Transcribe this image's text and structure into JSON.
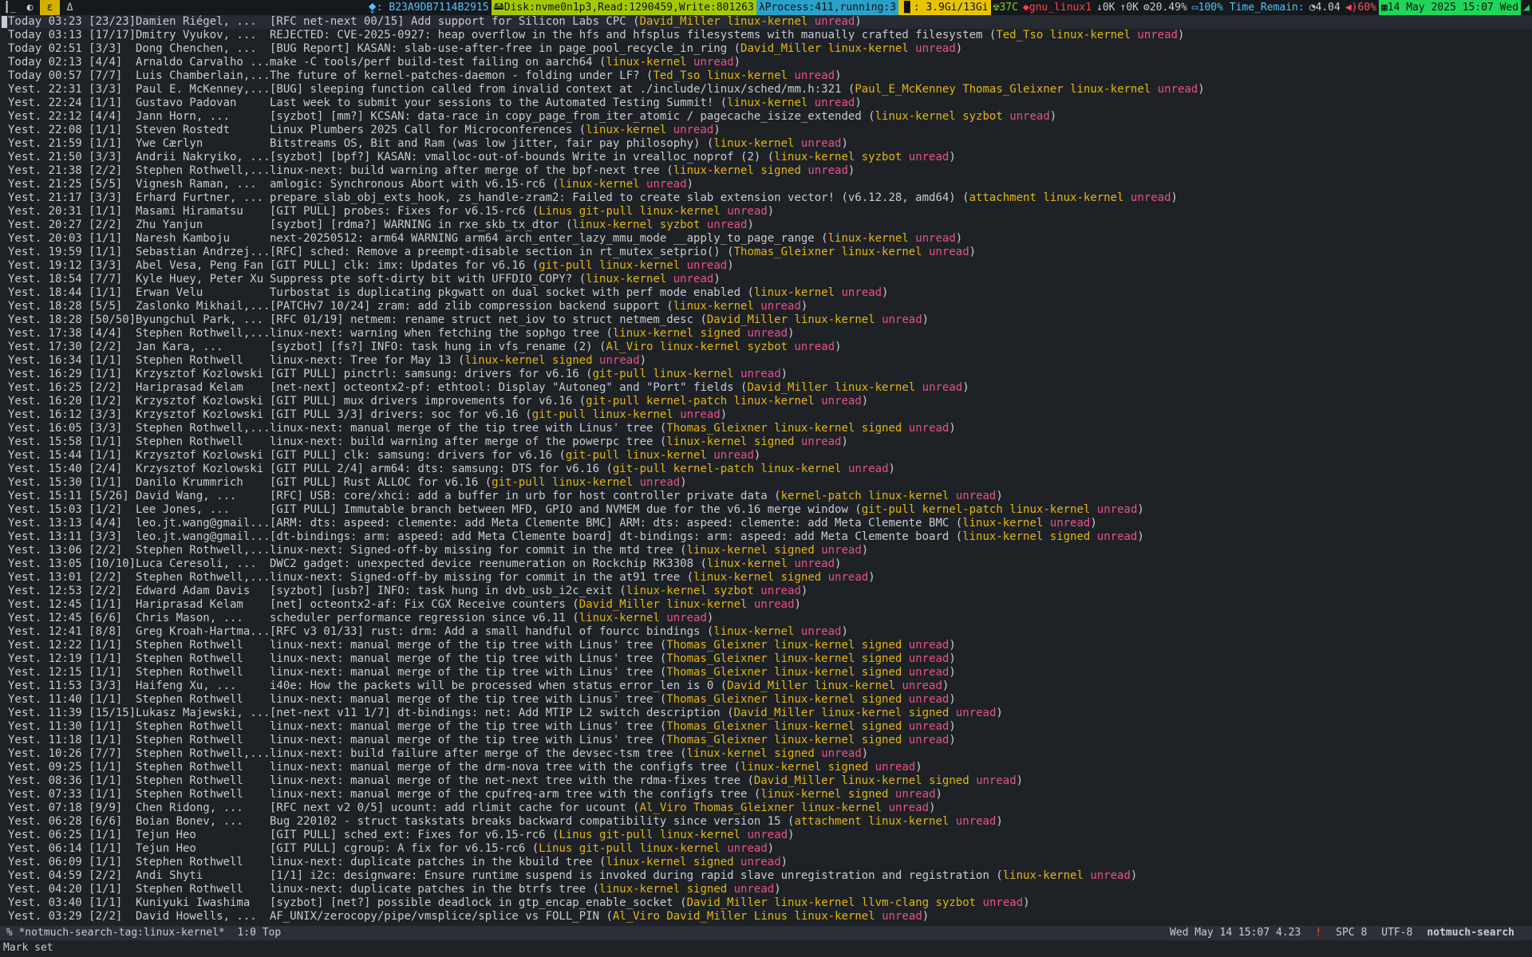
{
  "topbar": {
    "workspaces": [
      "┃_",
      "◐",
      "ε",
      "Δ"
    ],
    "active_workspace": 2,
    "ip_label": "⧪: B23A9DB7114B2915",
    "disk": "Disk:nvme0n1p3,Read:1290459,Write:801263",
    "process": "Process:411,running:3",
    "mem": ": 3.9Gi/13Gi",
    "temp": "37C",
    "wifi": "gnu_linux1",
    "down": "0K",
    "up": "0K",
    "cpu": "20.49%",
    "battery": "100% Time_Remain:",
    "load": "4.04",
    "volume": "60%",
    "datetime": "14 May 2025 15:07 Wed",
    "colors": {
      "disk": "#a4c900",
      "process": "#2aa1c9",
      "mem": "#e7c400",
      "temp": "#7ed321",
      "wifi": "#ff4545",
      "net": "#4fc3f7",
      "cpu": "#c8ccd2",
      "battery": "#4fc3f7",
      "load": "#c8ccd2",
      "volume": "#ff5555",
      "datetime": "#1fd65a"
    }
  },
  "emails": [
    {
      "date": "Today 03:23",
      "count": "[23/23]",
      "from": "Damien Riégel, ...",
      "subject": "[RFC net-next 00/15] Add support for Silicon Labs CPC",
      "tags": [
        "David_Miller",
        "linux-kernel",
        "unread"
      ]
    },
    {
      "date": "Today 03:13",
      "count": "[17/17]",
      "from": "Dmitry Vyukov, ...",
      "subject": "REJECTED: CVE-2025-0927: heap overflow in the hfs and hfsplus filesystems with manually crafted filesystem",
      "tags": [
        "Ted_Tso",
        "linux-kernel",
        "unread"
      ]
    },
    {
      "date": "Today 02:51",
      "count": "[3/3]",
      "from": "Dong Chenchen, ...",
      "subject": "[BUG Report] KASAN: slab-use-after-free in page_pool_recycle_in_ring",
      "tags": [
        "David_Miller",
        "linux-kernel",
        "unread"
      ]
    },
    {
      "date": "Today 02:13",
      "count": "[4/4]",
      "from": "Arnaldo Carvalho ...",
      "subject": "make -C tools/perf build-test failing on aarch64",
      "tags": [
        "linux-kernel",
        "unread"
      ]
    },
    {
      "date": "Today 00:57",
      "count": "[7/7]",
      "from": "Luis Chamberlain,...",
      "subject": "The future of kernel-patches-daemon - folding under LF?",
      "tags": [
        "Ted_Tso",
        "linux-kernel",
        "unread"
      ]
    },
    {
      "date": "Yest. 22:31",
      "count": "[3/3]",
      "from": "Paul E. McKenney,...",
      "subject": "[BUG] sleeping function called from invalid context at ./include/linux/sched/mm.h:321",
      "tags": [
        "Paul_E_McKenney",
        "Thomas_Gleixner",
        "linux-kernel",
        "unread"
      ]
    },
    {
      "date": "Yest. 22:24",
      "count": "[1/1]",
      "from": "Gustavo Padovan",
      "subject": "Last week to submit your sessions to the Automated Testing Summit!",
      "tags": [
        "linux-kernel",
        "unread"
      ]
    },
    {
      "date": "Yest. 22:12",
      "count": "[4/4]",
      "from": "Jann Horn, ...",
      "subject": "[syzbot] [mm?] KCSAN: data-race in copy_page_from_iter_atomic / pagecache_isize_extended",
      "tags": [
        "linux-kernel",
        "syzbot",
        "unread"
      ]
    },
    {
      "date": "Yest. 22:08",
      "count": "[1/1]",
      "from": "Steven Rostedt",
      "subject": "Linux Plumbers 2025 Call for Microconferences",
      "tags": [
        "linux-kernel",
        "unread"
      ]
    },
    {
      "date": "Yest. 21:59",
      "count": "[1/1]",
      "from": "Ywe Cærlyn",
      "subject": "Bitstreams OS, Bit and Ram (was low jitter, fair pay philosophy)",
      "tags": [
        "linux-kernel",
        "unread"
      ]
    },
    {
      "date": "Yest. 21:50",
      "count": "[3/3]",
      "from": "Andrii Nakryiko, ...",
      "subject": "[syzbot] [bpf?] KASAN: vmalloc-out-of-bounds Write in vrealloc_noprof (2)",
      "tags": [
        "linux-kernel",
        "syzbot",
        "unread"
      ]
    },
    {
      "date": "Yest. 21:38",
      "count": "[2/2]",
      "from": "Stephen Rothwell,...",
      "subject": "linux-next: build warning after merge of the bpf-next tree",
      "tags": [
        "linux-kernel",
        "signed",
        "unread"
      ]
    },
    {
      "date": "Yest. 21:25",
      "count": "[5/5]",
      "from": "Vignesh Raman, ...",
      "subject": "amlogic: Synchronous Abort with v6.15-rc6",
      "tags": [
        "linux-kernel",
        "unread"
      ]
    },
    {
      "date": "Yest. 21:17",
      "count": "[3/3]",
      "from": "Erhard Furtner, ...",
      "subject": "prepare_slab_obj_exts_hook, zs_handle-zram2: Failed to create slab extension vector! (v6.12.28, amd64)",
      "tags": [
        "attachment",
        "linux-kernel",
        "unread"
      ]
    },
    {
      "date": "Yest. 20:31",
      "count": "[1/1]",
      "from": "Masami Hiramatsu",
      "subject": "[GIT PULL] probes: Fixes for v6.15-rc6",
      "tags": [
        "Linus",
        "git-pull",
        "linux-kernel",
        "unread"
      ]
    },
    {
      "date": "Yest. 20:27",
      "count": "[2/2]",
      "from": "Zhu Yanjun",
      "subject": "[syzbot] [rdma?] WARNING in rxe_skb_tx_dtor",
      "tags": [
        "linux-kernel",
        "syzbot",
        "unread"
      ]
    },
    {
      "date": "Yest. 20:03",
      "count": "[1/1]",
      "from": "Naresh Kamboju",
      "subject": "next-20250512: arm64 WARNING arm64 arch_enter_lazy_mmu_mode __apply_to_page_range",
      "tags": [
        "linux-kernel",
        "unread"
      ]
    },
    {
      "date": "Yest. 19:59",
      "count": "[1/1]",
      "from": "Sebastian Andrzej...",
      "subject": "[RFC] sched: Remove a preempt-disable section in rt_mutex_setprio()",
      "tags": [
        "Thomas_Gleixner",
        "linux-kernel",
        "unread"
      ]
    },
    {
      "date": "Yest. 19:12",
      "count": "[3/3]",
      "from": "Abel Vesa, Peng Fan",
      "subject": "[GIT PULL] clk: imx: Updates for v6.16",
      "tags": [
        "git-pull",
        "linux-kernel",
        "unread"
      ]
    },
    {
      "date": "Yest. 18:54",
      "count": "[7/7]",
      "from": "Kyle Huey, Peter Xu",
      "subject": "Suppress pte soft-dirty bit with UFFDIO_COPY?",
      "tags": [
        "linux-kernel",
        "unread"
      ]
    },
    {
      "date": "Yest. 18:44",
      "count": "[1/1]",
      "from": "Erwan Velu",
      "subject": "Turbostat is duplicating pkgwatt on dual socket with perf mode enabled",
      "tags": [
        "linux-kernel",
        "unread"
      ]
    },
    {
      "date": "Yest. 18:28",
      "count": "[5/5]",
      "from": "Zaslonko Mikhail,...",
      "subject": "[PATCHv7 10/24] zram: add zlib compression backend support",
      "tags": [
        "linux-kernel",
        "unread"
      ]
    },
    {
      "date": "Yest. 18:28",
      "count": "[50/50]",
      "from": "Byungchul Park, ...",
      "subject": "[RFC 01/19] netmem: rename struct net_iov to struct netmem_desc",
      "tags": [
        "David_Miller",
        "linux-kernel",
        "unread"
      ]
    },
    {
      "date": "Yest. 17:38",
      "count": "[4/4]",
      "from": "Stephen Rothwell,...",
      "subject": "linux-next: warning when fetching the sophgo tree",
      "tags": [
        "linux-kernel",
        "signed",
        "unread"
      ]
    },
    {
      "date": "Yest. 17:30",
      "count": "[2/2]",
      "from": "Jan Kara, ...",
      "subject": "[syzbot] [fs?] INFO: task hung in vfs_rename (2)",
      "tags": [
        "Al_Viro",
        "linux-kernel",
        "syzbot",
        "unread"
      ]
    },
    {
      "date": "Yest. 16:34",
      "count": "[1/1]",
      "from": "Stephen Rothwell",
      "subject": "linux-next: Tree for May 13",
      "tags": [
        "linux-kernel",
        "signed",
        "unread"
      ]
    },
    {
      "date": "Yest. 16:29",
      "count": "[1/1]",
      "from": "Krzysztof Kozlowski",
      "subject": "[GIT PULL] pinctrl: samsung: drivers for v6.16",
      "tags": [
        "git-pull",
        "linux-kernel",
        "unread"
      ]
    },
    {
      "date": "Yest. 16:25",
      "count": "[2/2]",
      "from": "Hariprasad Kelam",
      "subject": "[net-next] octeontx2-pf: ethtool: Display \"Autoneg\" and \"Port\" fields",
      "tags": [
        "David_Miller",
        "linux-kernel",
        "unread"
      ]
    },
    {
      "date": "Yest. 16:20",
      "count": "[1/2]",
      "from": "Krzysztof Kozlowski",
      "subject": "[GIT PULL] mux drivers improvements for v6.16",
      "tags": [
        "git-pull",
        "kernel-patch",
        "linux-kernel",
        "unread"
      ]
    },
    {
      "date": "Yest. 16:12",
      "count": "[3/3]",
      "from": "Krzysztof Kozlowski",
      "subject": "[GIT PULL 3/3] drivers: soc for v6.16",
      "tags": [
        "git-pull",
        "linux-kernel",
        "unread"
      ]
    },
    {
      "date": "Yest. 16:05",
      "count": "[3/3]",
      "from": "Stephen Rothwell,...",
      "subject": "linux-next: manual merge of the tip tree with Linus' tree",
      "tags": [
        "Thomas_Gleixner",
        "linux-kernel",
        "signed",
        "unread"
      ]
    },
    {
      "date": "Yest. 15:58",
      "count": "[1/1]",
      "from": "Stephen Rothwell",
      "subject": "linux-next: build warning after merge of the powerpc tree",
      "tags": [
        "linux-kernel",
        "signed",
        "unread"
      ]
    },
    {
      "date": "Yest. 15:44",
      "count": "[1/1]",
      "from": "Krzysztof Kozlowski",
      "subject": "[GIT PULL] clk: samsung: drivers for v6.16",
      "tags": [
        "git-pull",
        "linux-kernel",
        "unread"
      ]
    },
    {
      "date": "Yest. 15:40",
      "count": "[2/4]",
      "from": "Krzysztof Kozlowski",
      "subject": "[GIT PULL 2/4] arm64: dts: samsung: DTS for v6.16",
      "tags": [
        "git-pull",
        "kernel-patch",
        "linux-kernel",
        "unread"
      ]
    },
    {
      "date": "Yest. 15:30",
      "count": "[1/1]",
      "from": "Danilo Krummrich",
      "subject": "[GIT PULL] Rust ALLOC for v6.16",
      "tags": [
        "git-pull",
        "linux-kernel",
        "unread"
      ]
    },
    {
      "date": "Yest. 15:11",
      "count": "[5/26]",
      "from": "David Wang, ...",
      "subject": "[RFC] USB: core/xhci: add a buffer in urb for host controller private data",
      "tags": [
        "kernel-patch",
        "linux-kernel",
        "unread"
      ]
    },
    {
      "date": "Yest. 15:03",
      "count": "[1/2]",
      "from": "Lee Jones, ...",
      "subject": "[GIT PULL] Immutable branch between MFD, GPIO and NVMEM due for the v6.16 merge window",
      "tags": [
        "git-pull",
        "kernel-patch",
        "linux-kernel",
        "unread"
      ]
    },
    {
      "date": "Yest. 13:13",
      "count": "[4/4]",
      "from": "leo.jt.wang@gmail...",
      "subject": "[ARM: dts: aspeed: clemente: add Meta Clemente BMC] ARM: dts: aspeed: clemente: add Meta Clemente BMC",
      "tags": [
        "linux-kernel",
        "unread"
      ]
    },
    {
      "date": "Yest. 13:11",
      "count": "[3/3]",
      "from": "leo.jt.wang@gmail...",
      "subject": "[dt-bindings: arm: aspeed: add Meta Clemente board] dt-bindings: arm: aspeed: add Meta Clemente board",
      "tags": [
        "linux-kernel",
        "signed",
        "unread"
      ]
    },
    {
      "date": "Yest. 13:06",
      "count": "[2/2]",
      "from": "Stephen Rothwell,...",
      "subject": "linux-next: Signed-off-by missing for commit in the mtd tree",
      "tags": [
        "linux-kernel",
        "signed",
        "unread"
      ]
    },
    {
      "date": "Yest. 13:05",
      "count": "[10/10]",
      "from": "Luca Ceresoli, ...",
      "subject": "DWC2 gadget: unexpected device reenumeration on Rockchip RK3308",
      "tags": [
        "linux-kernel",
        "unread"
      ]
    },
    {
      "date": "Yest. 13:01",
      "count": "[2/2]",
      "from": "Stephen Rothwell,...",
      "subject": "linux-next: Signed-off-by missing for commit in the at91 tree",
      "tags": [
        "linux-kernel",
        "signed",
        "unread"
      ]
    },
    {
      "date": "Yest. 12:53",
      "count": "[2/2]",
      "from": "Edward Adam Davis",
      "subject": "[syzbot] [usb?] INFO: task hung in dvb_usb_i2c_exit",
      "tags": [
        "linux-kernel",
        "syzbot",
        "unread"
      ]
    },
    {
      "date": "Yest. 12:45",
      "count": "[1/1]",
      "from": "Hariprasad Kelam",
      "subject": "[net] octeontx2-af: Fix CGX Receive counters",
      "tags": [
        "David_Miller",
        "linux-kernel",
        "unread"
      ]
    },
    {
      "date": "Yest. 12:45",
      "count": "[6/6]",
      "from": "Chris Mason, ...",
      "subject": "scheduler performance regression since v6.11",
      "tags": [
        "linux-kernel",
        "unread"
      ]
    },
    {
      "date": "Yest. 12:41",
      "count": "[8/8]",
      "from": "Greg Kroah-Hartma...",
      "subject": "[RFC v3 01/33] rust: drm: Add a small handful of fourcc bindings",
      "tags": [
        "linux-kernel",
        "unread"
      ]
    },
    {
      "date": "Yest. 12:22",
      "count": "[1/1]",
      "from": "Stephen Rothwell",
      "subject": "linux-next: manual merge of the tip tree with Linus' tree",
      "tags": [
        "Thomas_Gleixner",
        "linux-kernel",
        "signed",
        "unread"
      ]
    },
    {
      "date": "Yest. 12:19",
      "count": "[1/1]",
      "from": "Stephen Rothwell",
      "subject": "linux-next: manual merge of the tip tree with Linus' tree",
      "tags": [
        "Thomas_Gleixner",
        "linux-kernel",
        "signed",
        "unread"
      ]
    },
    {
      "date": "Yest. 12:15",
      "count": "[1/1]",
      "from": "Stephen Rothwell",
      "subject": "linux-next: manual merge of the tip tree with Linus' tree",
      "tags": [
        "Thomas_Gleixner",
        "linux-kernel",
        "signed",
        "unread"
      ]
    },
    {
      "date": "Yest. 11:53",
      "count": "[3/3]",
      "from": "Haifeng Xu, ...",
      "subject": "i40e: How the packets will be processed when status_error_len is 0",
      "tags": [
        "David_Miller",
        "linux-kernel",
        "unread"
      ]
    },
    {
      "date": "Yest. 11:40",
      "count": "[1/1]",
      "from": "Stephen Rothwell",
      "subject": "linux-next: manual merge of the tip tree with Linus' tree",
      "tags": [
        "Thomas_Gleixner",
        "linux-kernel",
        "signed",
        "unread"
      ]
    },
    {
      "date": "Yest. 11:39",
      "count": "[15/15]",
      "from": "Lukasz Majewski, ...",
      "subject": "[net-next v11 1/7] dt-bindings: net: Add MTIP L2 switch description",
      "tags": [
        "David_Miller",
        "linux-kernel",
        "signed",
        "unread"
      ]
    },
    {
      "date": "Yest. 11:30",
      "count": "[1/1]",
      "from": "Stephen Rothwell",
      "subject": "linux-next: manual merge of the tip tree with Linus' tree",
      "tags": [
        "Thomas_Gleixner",
        "linux-kernel",
        "signed",
        "unread"
      ]
    },
    {
      "date": "Yest. 11:18",
      "count": "[1/1]",
      "from": "Stephen Rothwell",
      "subject": "linux-next: manual merge of the tip tree with Linus' tree",
      "tags": [
        "Thomas_Gleixner",
        "linux-kernel",
        "signed",
        "unread"
      ]
    },
    {
      "date": "Yest. 10:26",
      "count": "[7/7]",
      "from": "Stephen Rothwell,...",
      "subject": "linux-next: build failure after merge of the devsec-tsm tree",
      "tags": [
        "linux-kernel",
        "signed",
        "unread"
      ]
    },
    {
      "date": "Yest. 09:25",
      "count": "[1/1]",
      "from": "Stephen Rothwell",
      "subject": "linux-next: manual merge of the drm-nova tree with the configfs tree",
      "tags": [
        "linux-kernel",
        "signed",
        "unread"
      ]
    },
    {
      "date": "Yest. 08:36",
      "count": "[1/1]",
      "from": "Stephen Rothwell",
      "subject": "linux-next: manual merge of the net-next tree with the rdma-fixes tree",
      "tags": [
        "David_Miller",
        "linux-kernel",
        "signed",
        "unread"
      ]
    },
    {
      "date": "Yest. 07:33",
      "count": "[1/1]",
      "from": "Stephen Rothwell",
      "subject": "linux-next: manual merge of the cpufreq-arm tree with the configfs tree",
      "tags": [
        "linux-kernel",
        "signed",
        "unread"
      ]
    },
    {
      "date": "Yest. 07:18",
      "count": "[9/9]",
      "from": "Chen Ridong, ...",
      "subject": "[RFC next v2 0/5] ucount: add rlimit cache for ucount",
      "tags": [
        "Al_Viro",
        "Thomas_Gleixner",
        "linux-kernel",
        "unread"
      ]
    },
    {
      "date": "Yest. 06:28",
      "count": "[6/6]",
      "from": "Boian Bonev, ...",
      "subject": "Bug 220102 - struct taskstats breaks backward compatibility since version 15",
      "tags": [
        "attachment",
        "linux-kernel",
        "unread"
      ]
    },
    {
      "date": "Yest. 06:25",
      "count": "[1/1]",
      "from": "Tejun Heo",
      "subject": "[GIT PULL] sched_ext: Fixes for v6.15-rc6",
      "tags": [
        "Linus",
        "git-pull",
        "linux-kernel",
        "unread"
      ]
    },
    {
      "date": "Yest. 06:14",
      "count": "[1/1]",
      "from": "Tejun Heo",
      "subject": "[GIT PULL] cgroup: A fix for v6.15-rc6",
      "tags": [
        "Linus",
        "git-pull",
        "linux-kernel",
        "unread"
      ]
    },
    {
      "date": "Yest. 06:09",
      "count": "[1/1]",
      "from": "Stephen Rothwell",
      "subject": "linux-next: duplicate patches in the kbuild tree",
      "tags": [
        "linux-kernel",
        "signed",
        "unread"
      ]
    },
    {
      "date": "Yest. 04:59",
      "count": "[2/2]",
      "from": "Andi Shyti",
      "subject": "[1/1] i2c: designware: Ensure runtime suspend is invoked during rapid slave unregistration and registration",
      "tags": [
        "linux-kernel",
        "unread"
      ]
    },
    {
      "date": "Yest. 04:20",
      "count": "[1/1]",
      "from": "Stephen Rothwell",
      "subject": "linux-next: duplicate patches in the btrfs tree",
      "tags": [
        "linux-kernel",
        "signed",
        "unread"
      ]
    },
    {
      "date": "Yest. 03:40",
      "count": "[1/1]",
      "from": "Kuniyuki Iwashima",
      "subject": "[syzbot] [net?] possible deadlock in gtp_encap_enable_socket",
      "tags": [
        "David_Miller",
        "linux-kernel",
        "llvm-clang",
        "syzbot",
        "unread"
      ]
    },
    {
      "date": "Yest. 03:29",
      "count": "[2/2]",
      "from": "David Howells, ...",
      "subject": "AF_UNIX/zerocopy/pipe/vmsplice/splice vs FOLL_PIN",
      "tags": [
        "Al_Viro",
        "David_Miller",
        "Linus",
        "linux-kernel",
        "unread"
      ]
    }
  ],
  "modeline": {
    "left": " % *notmuch-search-tag:linux-kernel*  1:0 Top",
    "datetime": "Wed May 14 15:07 4.23",
    "warning": "!",
    "spc": "SPC 8",
    "encoding": "UTF-8",
    "mode": "notmuch-search"
  },
  "minibuffer": "Mark set"
}
